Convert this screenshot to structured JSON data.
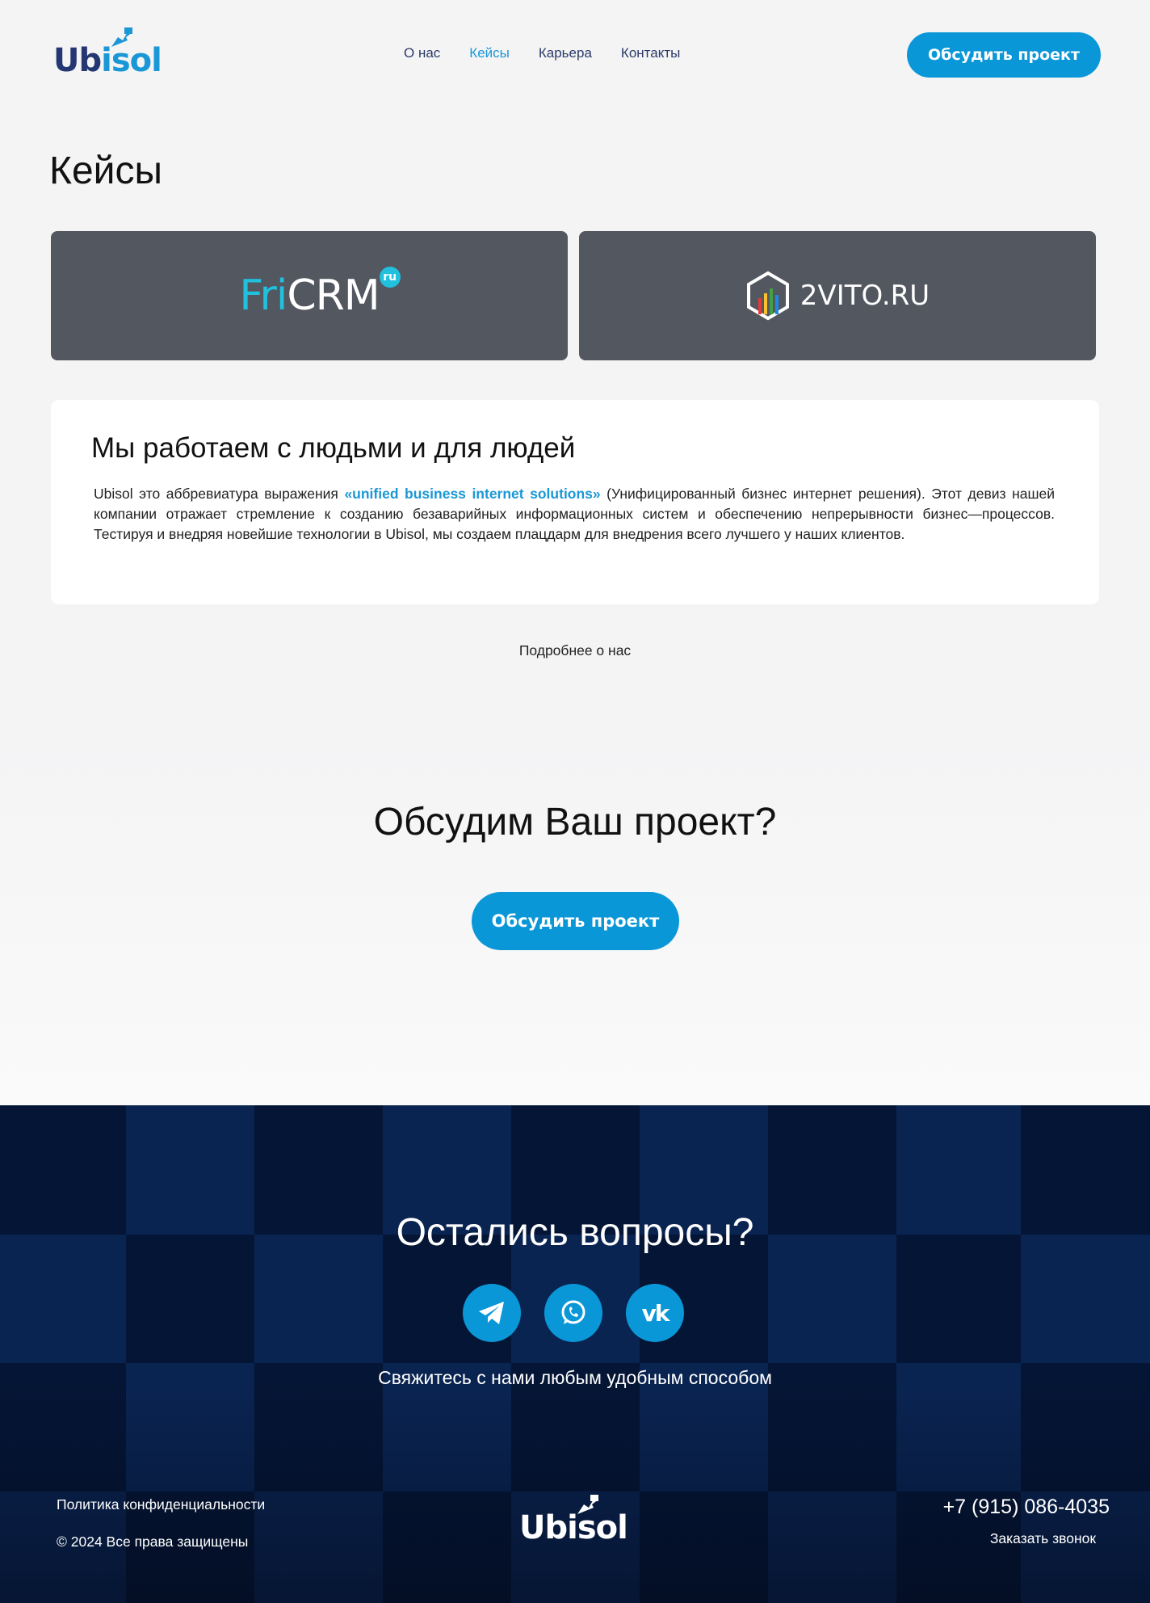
{
  "brand": {
    "logo_text_dark": "Ub",
    "logo_text_light": "isol",
    "name": "Ubisol"
  },
  "nav": {
    "items": [
      {
        "label": "О нас",
        "active": false
      },
      {
        "label": "Кейсы",
        "active": true
      },
      {
        "label": "Карьера",
        "active": false
      },
      {
        "label": "Контакты",
        "active": false
      }
    ]
  },
  "header": {
    "cta_label": "Обсудить проект"
  },
  "page": {
    "title": "Кейсы"
  },
  "cases": [
    {
      "logo_part1": "Fri",
      "logo_part2": "CRM",
      "badge": "ru"
    },
    {
      "logo_text": "2VITO.RU"
    }
  ],
  "about": {
    "title": "Мы работаем с людьми и для людей",
    "text_before": "Ubisol это аббревиатура выражения ",
    "highlight": "«unified business internet solutions»",
    "text_after": " (Унифицированный бизнес интернет решения). Этот девиз нашей компании отражает стремление к созданию безаварийных информационных систем и обеспечению непрерывности бизнес—процессов. Тестируя и внедряя новейшие технологии в Ubisol, мы создаем плацдарм для внедрения всего лучшего у наших клиентов.",
    "more_link": "Подробнее о нас"
  },
  "cta": {
    "title": "Обсудим Ваш проект?",
    "button": "Обсудить проект"
  },
  "footer": {
    "title": "Остались вопросы?",
    "socials": [
      "telegram-icon",
      "whatsapp-icon",
      "vk-icon"
    ],
    "subtitle": "Свяжитесь с нами любым удобным способом",
    "privacy": "Политика конфиденциальности",
    "copyright": "© 2024 Все права защищены",
    "phone": "+7 (915) 086-4035",
    "callback": "Заказать звонок"
  },
  "colors": {
    "accent": "#0a97d8",
    "brand_dark": "#253773",
    "card_dark": "#535760",
    "footer_navy": "#03112b"
  }
}
